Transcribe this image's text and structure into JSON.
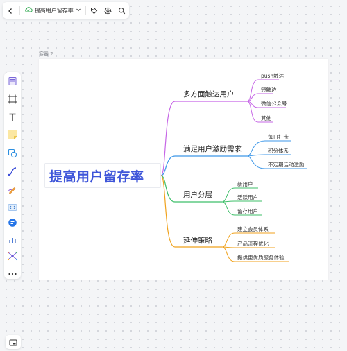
{
  "topbar": {
    "back_icon": "chevron-left-icon",
    "doc_icon": "cloud-sync-icon",
    "title": "提高用户留存率",
    "dropdown_icon": "chevron-down-icon",
    "tag_icon": "tag-icon",
    "settings_icon": "gear-icon",
    "search_icon": "search-icon"
  },
  "toolbar": {
    "tools": [
      "frame-template-icon",
      "crop-frame-icon",
      "text-icon",
      "sticky-note-icon",
      "shape-icon",
      "connector-icon",
      "pen-icon",
      "code-block-icon",
      "ai-assistant-icon",
      "chart-icon",
      "mindmap-icon",
      "more-icon"
    ]
  },
  "canvas": {
    "frame_label": "容器 2"
  },
  "mindmap": {
    "root": "提高用户留存率",
    "branches": [
      {
        "label": "多方面触达用户",
        "color": "#c666e6",
        "children": [
          "push触达",
          "短触达",
          "微信公众号",
          "其他"
        ]
      },
      {
        "label": "满足用户激励需求",
        "color": "#3d97e8",
        "children": [
          "每日打卡",
          "积分体系",
          "不定期活动激励"
        ]
      },
      {
        "label": "用户分层",
        "color": "#3fbf6a",
        "children": [
          "新用户",
          "活跃用户",
          "留存用户"
        ]
      },
      {
        "label": "延伸策略",
        "color": "#f0a21c",
        "children": [
          "建立会员体系",
          "产品流程优化",
          "提供更优质服务体验"
        ]
      }
    ]
  },
  "bottom": {
    "icon": "minimap-icon"
  }
}
